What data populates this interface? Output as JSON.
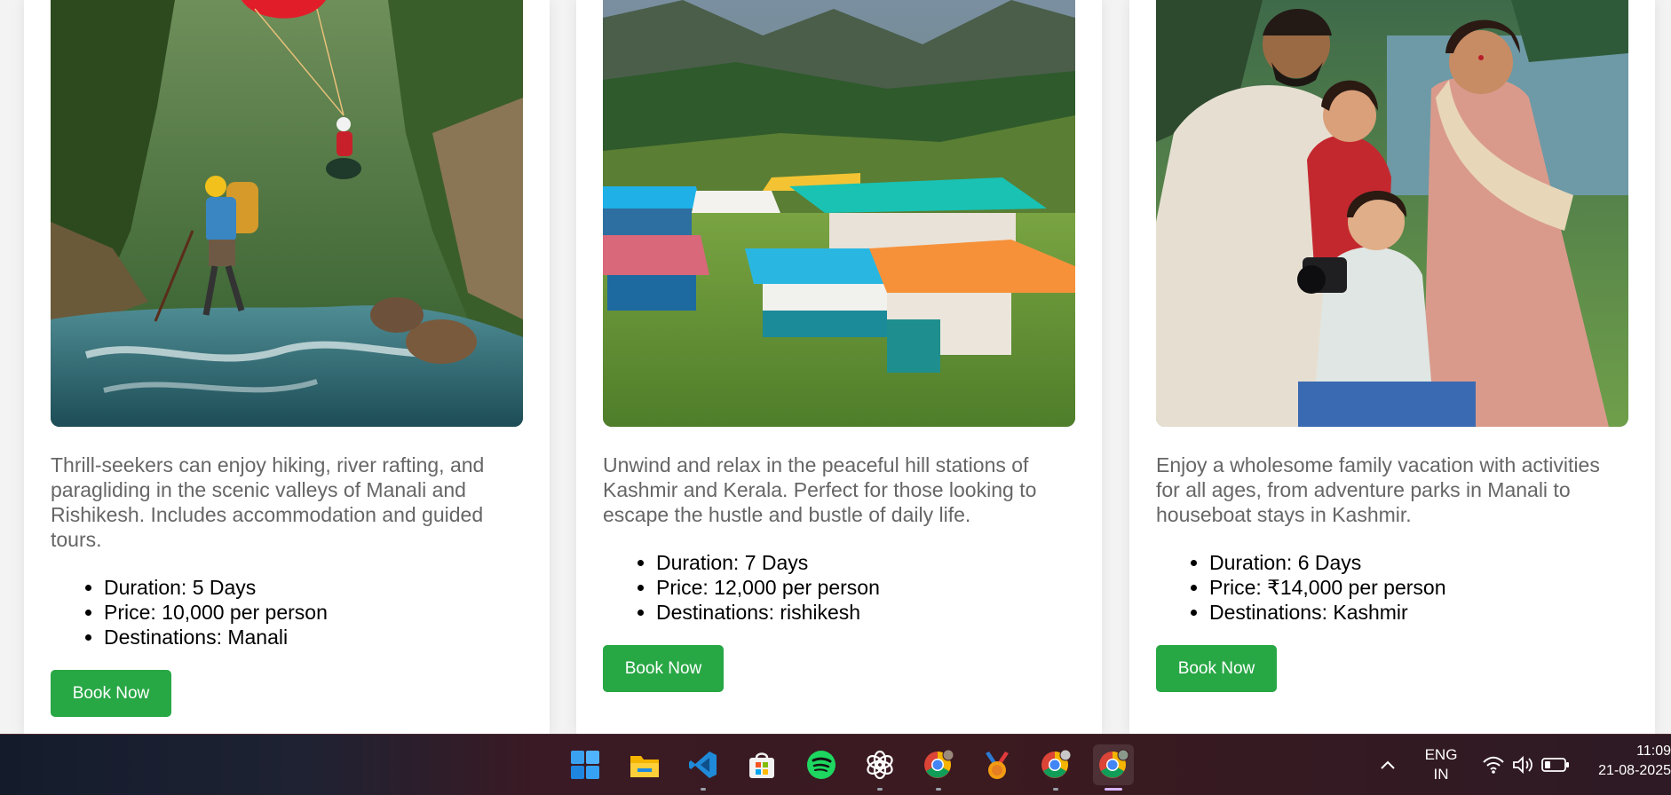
{
  "cards": [
    {
      "description": "Thrill-seekers can enjoy hiking, river rafting, and paragliding in the scenic valleys of Manali and Rishikesh. Includes accommodation and guided tours.",
      "details": [
        "Duration: 5 Days",
        "Price: 10,000 per person",
        "Destinations: Manali"
      ],
      "button_label": "Book Now",
      "image": "adventure-rafting-paragliding"
    },
    {
      "description": "Unwind and relax in the peaceful hill stations of Kashmir and Kerala. Perfect for those looking to escape the hustle and bustle of daily life.",
      "details": [
        "Duration: 7 Days",
        "Price: 12,000 per person",
        "Destinations: rishikesh"
      ],
      "button_label": "Book Now",
      "image": "hill-station-houses"
    },
    {
      "description": "Enjoy a wholesome family vacation with activities for all ages, from adventure parks in Manali to houseboat stays in Kashmir.",
      "details": [
        "Duration: 6 Days",
        "Price: ₹14,000 per person",
        "Destinations: Kashmir"
      ],
      "button_label": "Book Now",
      "image": "family-by-lake"
    }
  ],
  "taskbar": {
    "apps": [
      "windows-start-icon",
      "file-explorer-icon",
      "vscode-icon",
      "microsoft-store-icon",
      "spotify-icon",
      "chatgpt-icon",
      "chrome-profile-1-icon",
      "medal-app-icon",
      "chrome-profile-2-icon",
      "chrome-profile-3-icon"
    ],
    "language_top": "ENG",
    "language_bottom": "IN",
    "time": "11:09",
    "date": "21-08-2025"
  },
  "colors": {
    "button": "#28a745",
    "description_text": "#666666",
    "page_background": "#f3f3f3"
  }
}
